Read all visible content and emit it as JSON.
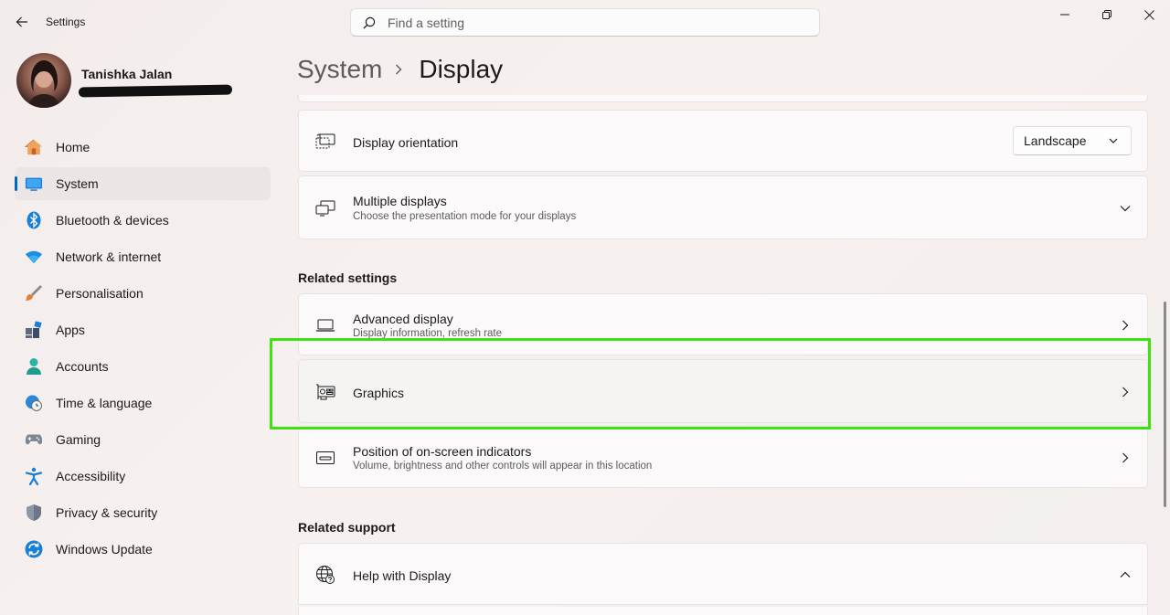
{
  "window": {
    "title": "Settings"
  },
  "search": {
    "placeholder": "Find a setting"
  },
  "profile": {
    "name": "Tanishka Jalan"
  },
  "sidebar": {
    "items": [
      {
        "label": "Home",
        "icon": "home-icon"
      },
      {
        "label": "System",
        "icon": "system-icon",
        "selected": true
      },
      {
        "label": "Bluetooth & devices",
        "icon": "bluetooth-icon"
      },
      {
        "label": "Network & internet",
        "icon": "wifi-icon"
      },
      {
        "label": "Personalisation",
        "icon": "brush-icon"
      },
      {
        "label": "Apps",
        "icon": "apps-icon"
      },
      {
        "label": "Accounts",
        "icon": "accounts-icon"
      },
      {
        "label": "Time & language",
        "icon": "globe-clock-icon"
      },
      {
        "label": "Gaming",
        "icon": "gamepad-icon"
      },
      {
        "label": "Accessibility",
        "icon": "accessibility-icon"
      },
      {
        "label": "Privacy & security",
        "icon": "shield-icon"
      },
      {
        "label": "Windows Update",
        "icon": "update-icon"
      }
    ]
  },
  "breadcrumb": {
    "parent": "System",
    "current": "Display"
  },
  "cards": {
    "orientation": {
      "title": "Display orientation",
      "value": "Landscape"
    },
    "multiple": {
      "title": "Multiple displays",
      "subtitle": "Choose the presentation mode for your displays"
    },
    "advanced": {
      "title": "Advanced display",
      "subtitle": "Display information, refresh rate"
    },
    "graphics": {
      "title": "Graphics"
    },
    "position": {
      "title": "Position of on-screen indicators",
      "subtitle": "Volume, brightness and other controls will appear in this location"
    },
    "help": {
      "title": "Help with Display"
    }
  },
  "sections": {
    "related_settings": "Related settings",
    "related_support": "Related support"
  },
  "colors": {
    "accent": "#0067c0",
    "highlight": "#3fe014"
  }
}
